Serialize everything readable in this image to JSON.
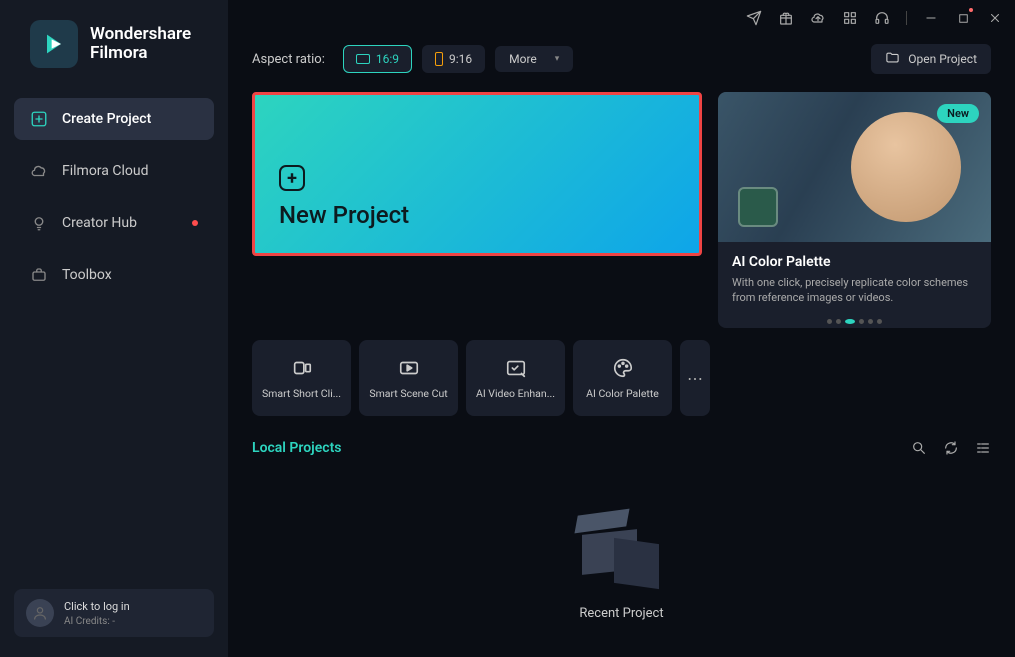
{
  "brand": {
    "line1": "Wondershare",
    "line2": "Filmora"
  },
  "sidebar": {
    "items": [
      {
        "label": "Create Project"
      },
      {
        "label": "Filmora Cloud"
      },
      {
        "label": "Creator Hub"
      },
      {
        "label": "Toolbox"
      }
    ]
  },
  "footer": {
    "login": "Click to log in",
    "credits": "AI Credits: -"
  },
  "toolbar": {
    "aspect_label": "Aspect ratio:",
    "ar_16_9": "16:9",
    "ar_9_16": "9:16",
    "more": "More",
    "open_project": "Open Project"
  },
  "new_project": {
    "label": "New Project"
  },
  "promo": {
    "badge": "New",
    "title": "AI Color Palette",
    "desc": "With one click, precisely replicate color schemes from reference images or videos."
  },
  "tools": [
    {
      "label": "Smart Short Cli..."
    },
    {
      "label": "Smart Scene Cut"
    },
    {
      "label": "AI Video Enhan..."
    },
    {
      "label": "AI Color Palette"
    }
  ],
  "local": {
    "title": "Local Projects",
    "recent": "Recent Project"
  }
}
